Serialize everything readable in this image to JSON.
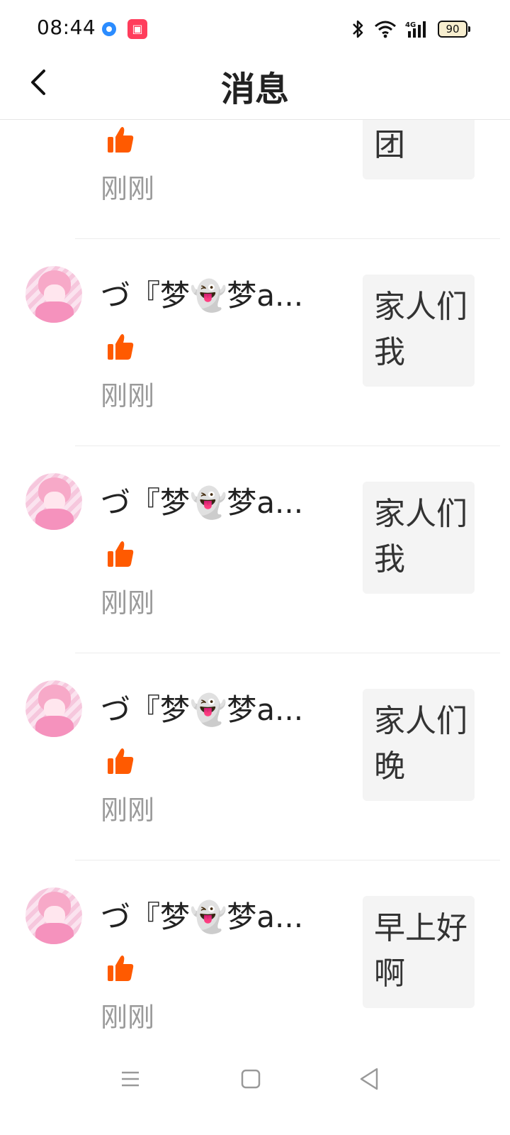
{
  "status_bar": {
    "time": "08:44",
    "battery": "90",
    "network": "4G",
    "app_icons": [
      "browser-icon",
      "video-app-icon"
    ]
  },
  "header": {
    "title": "消息"
  },
  "messages": [
    {
      "username": "",
      "timestamp": "刚刚",
      "preview": "谁要进团",
      "partial": true
    },
    {
      "username": "づ『梦👻梦a...",
      "timestamp": "刚刚",
      "preview": "家人们我"
    },
    {
      "username": "づ『梦👻梦a...",
      "timestamp": "刚刚",
      "preview": "家人们我"
    },
    {
      "username": "づ『梦👻梦a...",
      "timestamp": "刚刚",
      "preview": "家人们晚"
    },
    {
      "username": "づ『梦👻梦a...",
      "timestamp": "刚刚",
      "preview": "早上好啊"
    }
  ],
  "colors": {
    "like": "#ff5a00",
    "timestamp": "#9a9a9a",
    "preview_bg": "#f4f4f4"
  }
}
